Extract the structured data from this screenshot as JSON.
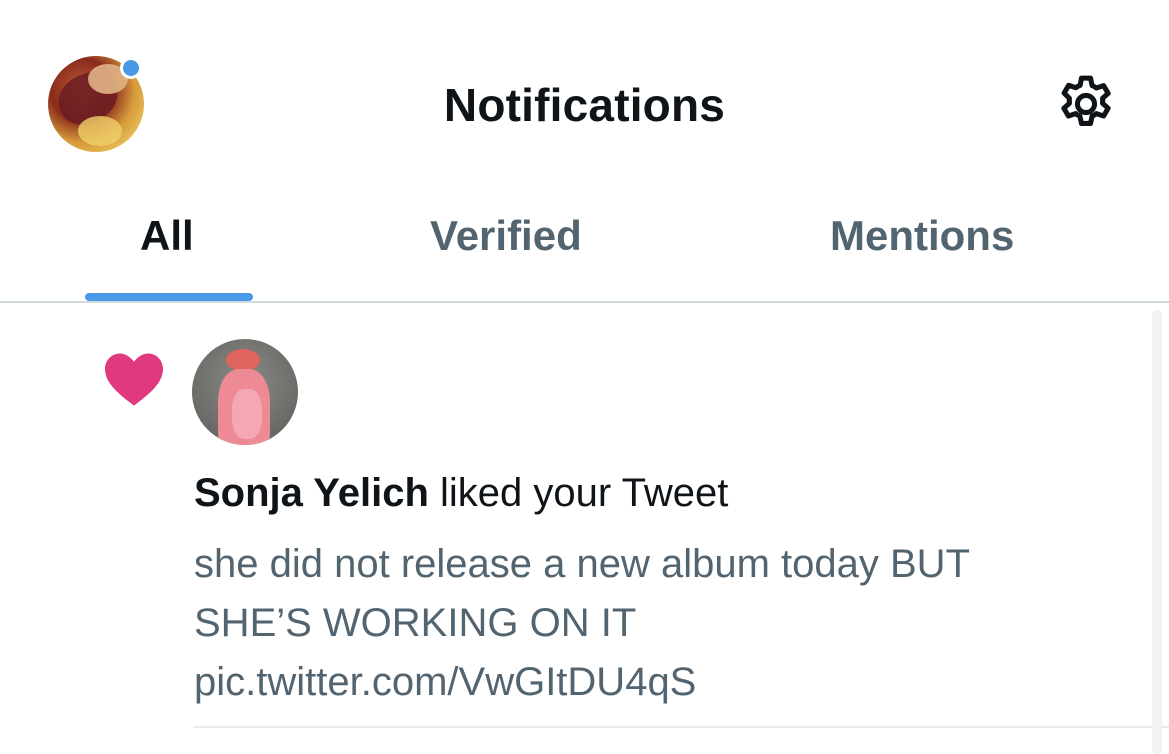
{
  "header": {
    "title": "Notifications",
    "avatar_icon": "profile-avatar",
    "unread_dot_color": "#4a99e9",
    "settings_icon": "gear-icon"
  },
  "tabs": [
    {
      "label": "All",
      "active": true
    },
    {
      "label": "Verified",
      "active": false
    },
    {
      "label": "Mentions",
      "active": false
    }
  ],
  "accent_color": "#4a99e9",
  "notification": {
    "type_icon": "heart-icon",
    "icon_color": "#e0397f",
    "user_name": "Sonja Yelich",
    "action_text": " liked your Tweet",
    "tweet_text": "she did not release a new album today BUT SHE’S WORKING ON IT pic.twitter.com/VwGItDU4qS"
  }
}
